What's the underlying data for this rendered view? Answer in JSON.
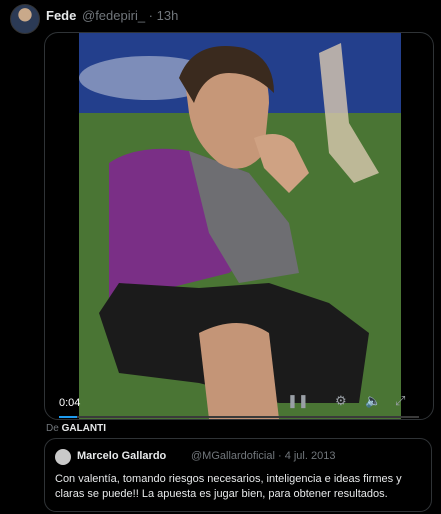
{
  "tweet": {
    "author_name": "Fede",
    "author_handle_time": "@fedepiri_ · 13h"
  },
  "video": {
    "time": "0:04",
    "progress_fraction": 0.05
  },
  "attribution": {
    "prefix": "De ",
    "source": "GALANTI"
  },
  "quoted": {
    "name": "Marcelo Gallardo",
    "handle_date": "@MGallardoficial · 4 jul. 2013",
    "text": "Con valentía, tomando riesgos necesarios, inteligencia e ideas firmes y claras se puede!! La apuesta es jugar bien, para obtener resultados."
  },
  "colors": {
    "accent": "#1d9bf0",
    "background": "#000000",
    "secondary_text": "#71767b"
  }
}
